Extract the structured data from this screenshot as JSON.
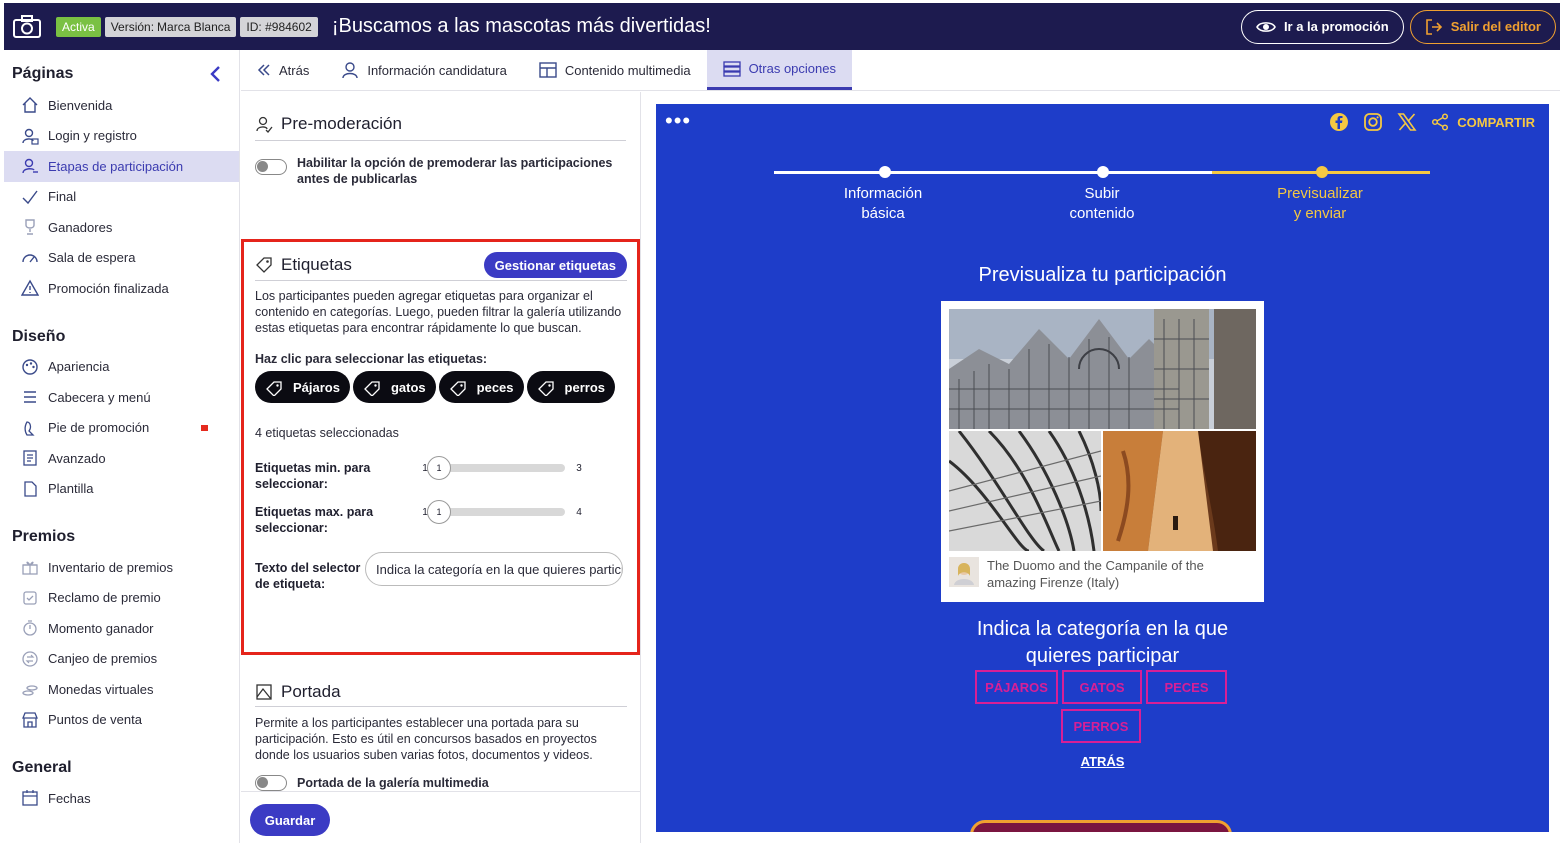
{
  "topbar": {
    "status_badge": "Activa",
    "version_label": "Versión:",
    "version_value": "Marca Blanca",
    "id_badge": "ID: #984602",
    "title": "¡Buscamos a las mascotas más divertidas!",
    "go_promo": "Ir a la promoción",
    "exit_editor": "Salir del editor"
  },
  "sidebar": {
    "pages_title": "Páginas",
    "pages": [
      {
        "label": "Bienvenida",
        "icon": "home-icon"
      },
      {
        "label": "Login y registro",
        "icon": "user-lock-icon"
      },
      {
        "label": "Etapas de participación",
        "icon": "user-steps-icon"
      },
      {
        "label": "Final",
        "icon": "check-icon"
      },
      {
        "label": "Ganadores",
        "icon": "trophy-icon"
      },
      {
        "label": "Sala de espera",
        "icon": "gauge-icon"
      },
      {
        "label": "Promoción finalizada",
        "icon": "warning-icon"
      }
    ],
    "design_title": "Diseño",
    "design": [
      {
        "label": "Apariencia",
        "icon": "palette-icon"
      },
      {
        "label": "Cabecera y menú",
        "icon": "menu-icon"
      },
      {
        "label": "Pie de promoción",
        "icon": "footprint-icon"
      },
      {
        "label": "Avanzado",
        "icon": "advanced-icon"
      },
      {
        "label": "Plantilla",
        "icon": "file-icon"
      }
    ],
    "prizes_title": "Premios",
    "prizes": [
      {
        "label": "Inventario de premios",
        "icon": "gift-icon"
      },
      {
        "label": "Reclamo de premio",
        "icon": "claim-icon"
      },
      {
        "label": "Momento ganador",
        "icon": "stopwatch-icon"
      },
      {
        "label": "Canjeo de premios",
        "icon": "exchange-icon"
      },
      {
        "label": "Monedas virtuales",
        "icon": "coins-icon"
      },
      {
        "label": "Puntos de venta",
        "icon": "store-icon"
      }
    ],
    "general_title": "General",
    "general": [
      {
        "label": "Fechas",
        "icon": "calendar-icon"
      }
    ]
  },
  "tabs": {
    "back": "Atrás",
    "candidacy": "Información candidatura",
    "media": "Contenido multimedia",
    "other": "Otras opciones"
  },
  "editor": {
    "premod_title": "Pre-moderación",
    "premod_text": "Habilitar la opción de premoderar las participaciones antes de publicarlas",
    "tags_title": "Etiquetas",
    "manage_tags": "Gestionar etiquetas",
    "tags_desc": "Los participantes pueden agregar etiquetas para organizar el contenido en categorías. Luego, pueden filtrar la galería utilizando estas etiquetas para encontrar rápidamente lo que buscan.",
    "tags_select_label": "Haz clic para seleccionar las etiquetas:",
    "tags": [
      "Pájaros",
      "gatos",
      "peces",
      "perros"
    ],
    "tags_count": "4 etiquetas seleccionadas",
    "min_label": "Etiquetas min. para seleccionar:",
    "min_left": "1",
    "min_value": "1",
    "min_right": "3",
    "max_label": "Etiquetas max. para seleccionar:",
    "max_left": "1",
    "max_value": "1",
    "max_right": "4",
    "selector_label": "Texto del selector de etiqueta:",
    "selector_value": "Indica la categoría en la que quieres participar",
    "cover_title": "Portada",
    "cover_desc": "Permite a los participantes establecer una portada para su participación. Esto es útil en concursos basados en proyectos donde los usuarios suben varias fotos, documentos y videos.",
    "cover_toggle": "Portada de la galería multimedia",
    "save": "Guardar"
  },
  "preview": {
    "dots": "•••",
    "share": "COMPARTIR",
    "steps": [
      {
        "line1": "Información",
        "line2": "básica"
      },
      {
        "line1": "Subir",
        "line2": "contenido"
      },
      {
        "line1": "Previsualizar",
        "line2": "y enviar"
      }
    ],
    "title": "Previsualiza tu participación",
    "caption": "The Duomo and the Campanile of the amazing Firenze (Italy)",
    "question_line1": "Indica la categoría en la que",
    "question_line2": "quieres participar",
    "tag_buttons": [
      "Pájaros",
      "gatos",
      "peces",
      "perros"
    ],
    "back": "ATRÁS"
  },
  "colors": {
    "topbar": "#1d1b4f",
    "accent": "#3b3bc4",
    "preview_bg": "#1e3dc9",
    "highlight": "#f5c842",
    "tag_pink": "#d81f96",
    "red_outline": "#e5241b"
  }
}
